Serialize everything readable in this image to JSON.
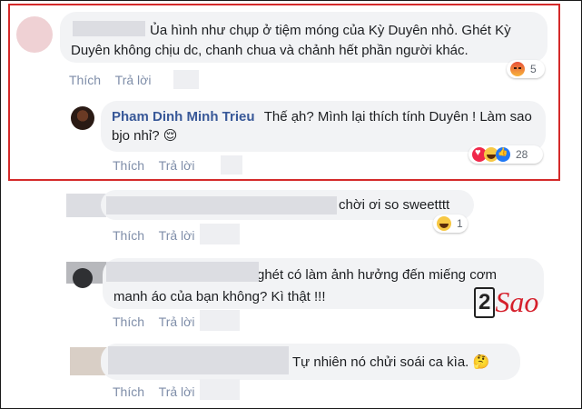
{
  "comments": [
    {
      "text": "Ủa hình như chụp ở tiệm móng của Kỳ Duyên nhỏ. Ghét Kỳ Duyên không chịu dc, chanh chua và chảnh hết phần người khác.",
      "actions": {
        "like": "Thích",
        "reply": "Trả lời"
      },
      "reaction": {
        "icons": [
          "angry-icon"
        ],
        "count": "5"
      },
      "reply": {
        "author": "Pham Dinh Minh Trieu",
        "text": "Thế ạh? Mình lại thích tính Duyên ! Làm sao bjo nhỉ? 😌",
        "actions": {
          "like": "Thích",
          "reply": "Trả lời"
        },
        "reaction": {
          "icons": [
            "love-icon",
            "haha-icon",
            "like-icon"
          ],
          "count": "28"
        }
      }
    },
    {
      "text": "chời ơi so sweetttt",
      "actions": {
        "like": "Thích",
        "reply": "Trả lời"
      },
      "reaction": {
        "icons": [
          "haha-icon"
        ],
        "count": "1"
      }
    },
    {
      "text": "ghét có làm ảnh hưởng đến miếng cơm manh áo của bạn không? Kì thật !!!",
      "actions": {
        "like": "Thích",
        "reply": "Trả lời"
      }
    },
    {
      "text": "Tự nhiên nó chửi soái ca kìa. 🤔",
      "actions": {
        "like": "Thích",
        "reply": "Trả lời"
      }
    }
  ],
  "watermark": {
    "digit": "2",
    "word": "Sao"
  },
  "colors": {
    "highlight": "#d42a2a",
    "name": "#385898",
    "bubble": "#f2f3f5",
    "action": "#7f8ea9"
  }
}
